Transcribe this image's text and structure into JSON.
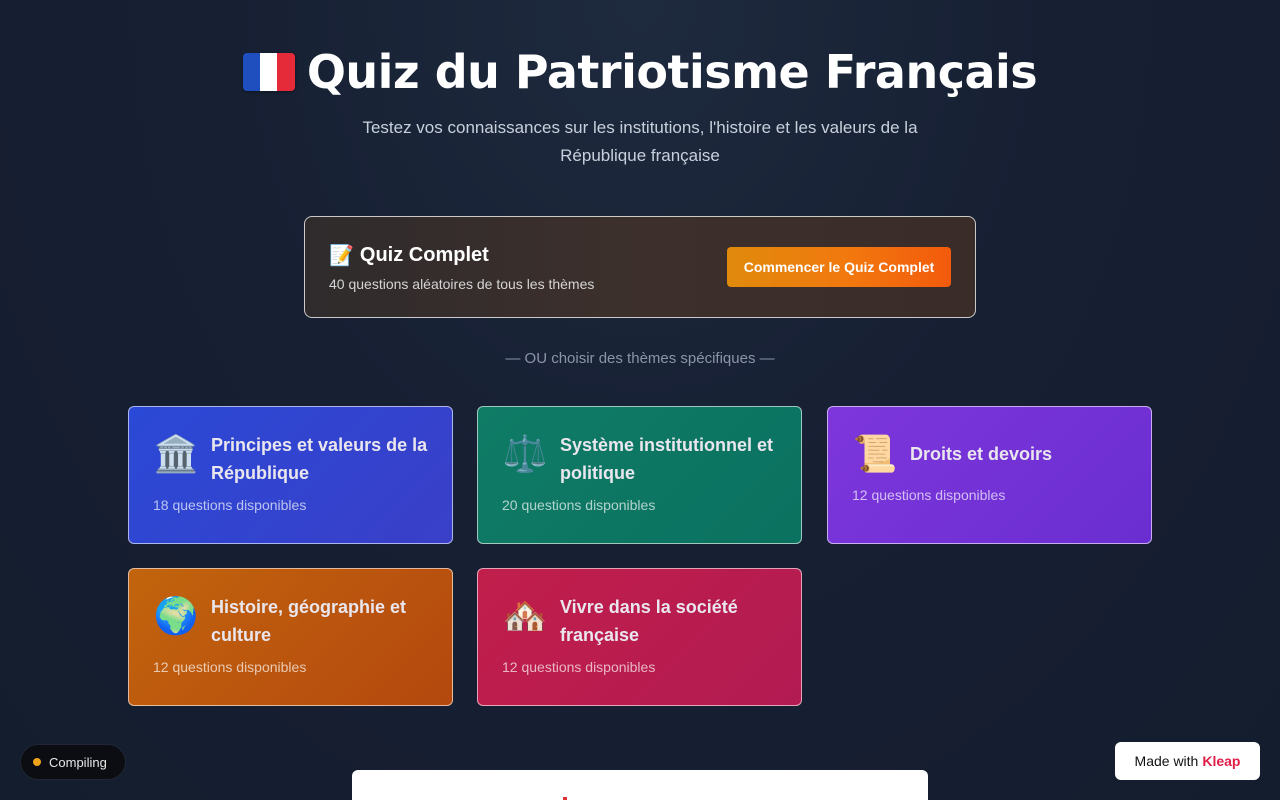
{
  "header": {
    "title": "Quiz du Patriotisme Français",
    "subtitle": "Testez vos connaissances sur les institutions, l'histoire et les valeurs de la République française",
    "flag_colors": [
      "#1f4fbf",
      "#ffffff",
      "#e52b3a"
    ]
  },
  "full_quiz": {
    "icon": "📝",
    "title": "Quiz Complet",
    "description": "40 questions aléatoires de tous les thèmes",
    "button_label": "Commencer le Quiz Complet"
  },
  "separator": "— OU choisir des thèmes spécifiques —",
  "themes": [
    {
      "icon": "🏛️",
      "title": "Principes et valeurs de la République",
      "count": "18 questions disponibles",
      "color": "#2f46d4"
    },
    {
      "icon": "⚖️",
      "title": "Système institutionnel et politique",
      "count": "20 questions disponibles",
      "color": "#0e7765"
    },
    {
      "icon": "📜",
      "title": "Droits et devoirs",
      "count": "12 questions disponibles",
      "color": "#7533d8"
    },
    {
      "icon": "🌍",
      "title": "Histoire, géographie et culture",
      "count": "12 questions disponibles",
      "color": "#bd580d"
    },
    {
      "icon": "🏘️",
      "title": "Vivre dans la société française",
      "count": "12 questions disponibles",
      "color": "#bb1d4d"
    }
  ],
  "status": {
    "label": "Compiling"
  },
  "badge": {
    "prefix": "Made with",
    "brand": "Kleap"
  }
}
